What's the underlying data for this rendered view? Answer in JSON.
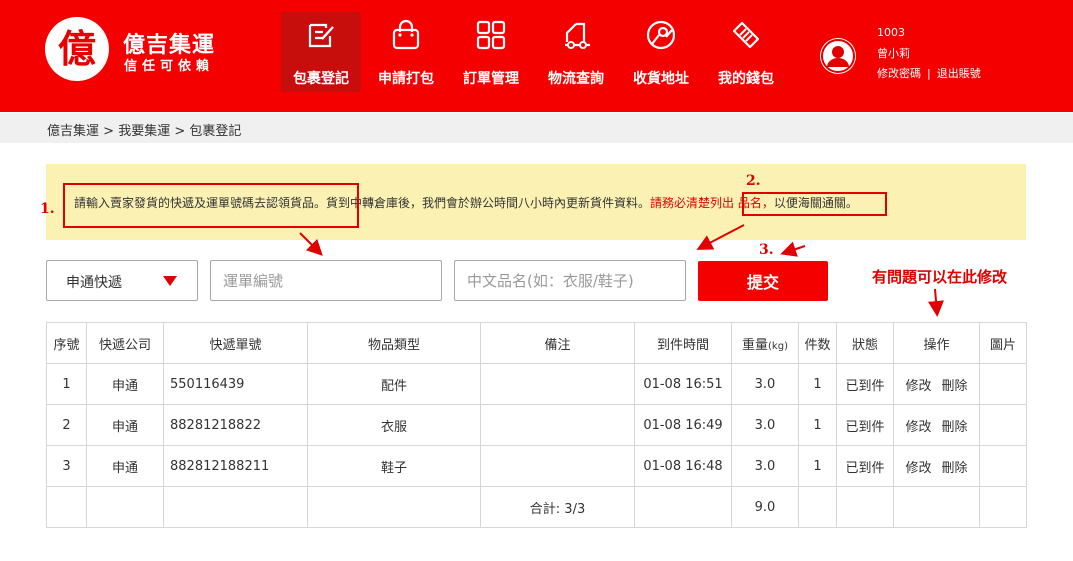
{
  "brand": {
    "logo_char": "億",
    "name": "億吉集運",
    "slogan": "信任可依賴"
  },
  "nav": [
    {
      "label": "包裹登記",
      "icon": "edit-icon",
      "active": true
    },
    {
      "label": "申請打包",
      "icon": "bag-icon",
      "active": false
    },
    {
      "label": "訂單管理",
      "icon": "grid-icon",
      "active": false
    },
    {
      "label": "物流查詢",
      "icon": "truck-icon",
      "active": false
    },
    {
      "label": "收貨地址",
      "icon": "location-icon",
      "active": false
    },
    {
      "label": "我的錢包",
      "icon": "wallet-icon",
      "active": false
    }
  ],
  "user": {
    "id": "1003",
    "name": "曾小莉",
    "change_password": "修改密碼",
    "separator": "|",
    "logout": "退出賬號"
  },
  "breadcrumb": {
    "items": [
      "億吉集運",
      "我要集運",
      "包裹登記"
    ],
    "separator": ">"
  },
  "notice": {
    "part1": "請輸入賣家發貨的快遞及運單號碼去認領貨品。",
    "part2": "貨到中轉倉庫後，我們會於辦公時間八小時內更新貨件資料。",
    "part3": "請務必清楚列出 品名，",
    "part4": "以便海關通關。"
  },
  "annotations": {
    "step1": "1.",
    "step2": "2.",
    "step3": "3.",
    "edit_hint": "有問題可以在此修改"
  },
  "form": {
    "courier_selected": "申通快遞",
    "tracking_placeholder": "運單編號",
    "product_placeholder": "中文品名(如：衣服/鞋子)",
    "submit_label": "提交"
  },
  "table": {
    "headers": {
      "seq": "序號",
      "courier": "快遞公司",
      "tracking": "快遞單號",
      "type": "物品類型",
      "remark": "備注",
      "arrival": "到件時間",
      "weight": "重量",
      "weight_unit": "(kg)",
      "count": "件数",
      "status": "狀態",
      "ops": "操作",
      "image": "圖片"
    },
    "rows": [
      {
        "seq": "1",
        "courier": "申通",
        "tracking": "550116439",
        "type": "配件",
        "remark": "",
        "arrival": "01-08 16:51",
        "weight": "3.0",
        "count": "1",
        "status": "已到件",
        "edit": "修改",
        "delete": "刪除"
      },
      {
        "seq": "2",
        "courier": "申通",
        "tracking": "88281218822",
        "type": "衣服",
        "remark": "",
        "arrival": "01-08 16:49",
        "weight": "3.0",
        "count": "1",
        "status": "已到件",
        "edit": "修改",
        "delete": "刪除"
      },
      {
        "seq": "3",
        "courier": "申通",
        "tracking": "882812188211",
        "type": "鞋子",
        "remark": "",
        "arrival": "01-08 16:48",
        "weight": "3.0",
        "count": "1",
        "status": "已到件",
        "edit": "修改",
        "delete": "刪除"
      }
    ],
    "summary": {
      "total_label": "合計: 3/3",
      "total_weight": "9.0"
    }
  },
  "colors": {
    "brand_red": "#f50000",
    "active_nav": "#c80d0d",
    "notice_bg": "#fbf1b3",
    "annotation_red": "#e00000"
  }
}
